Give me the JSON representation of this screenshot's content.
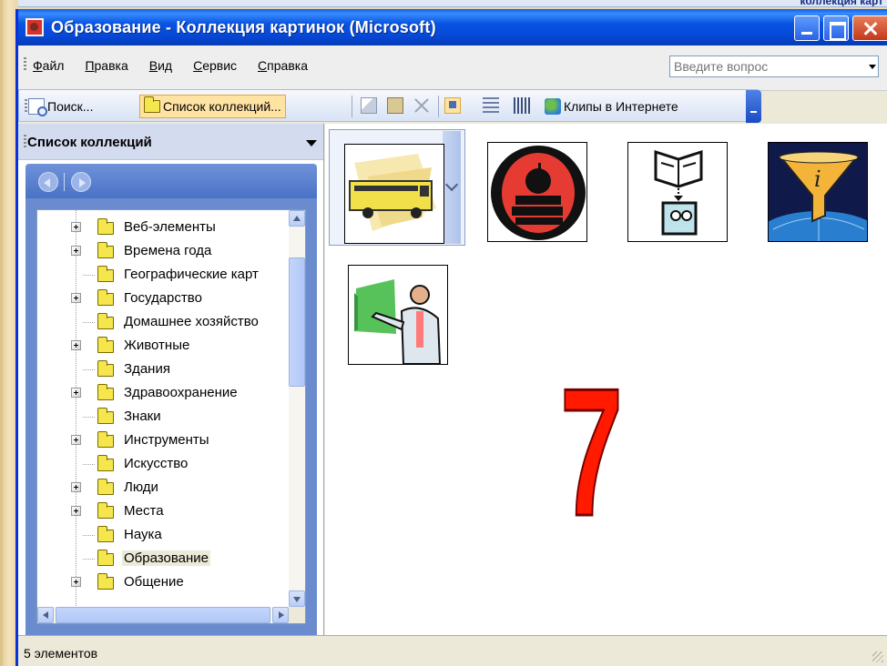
{
  "behind_window": {
    "title_fragment": "коллекция карт"
  },
  "window": {
    "title": "Образование - Коллекция картинок (Microsoft)"
  },
  "menu": {
    "items": [
      "Файл",
      "Правка",
      "Вид",
      "Сервис",
      "Справка"
    ],
    "ask_placeholder": "Введите вопрос"
  },
  "toolbar": {
    "search_label": "Поиск...",
    "collections_label": "Список коллекций...",
    "web_clips_label": "Клипы в Интернете"
  },
  "task_pane": {
    "title": "Список коллекций",
    "tree": [
      {
        "label": "Веб-элементы",
        "expandable": true,
        "selected": false
      },
      {
        "label": "Времена года",
        "expandable": true,
        "selected": false
      },
      {
        "label": "Географические карт",
        "expandable": false,
        "selected": false
      },
      {
        "label": "Государство",
        "expandable": true,
        "selected": false
      },
      {
        "label": "Домашнее хозяйство",
        "expandable": false,
        "selected": false
      },
      {
        "label": "Животные",
        "expandable": true,
        "selected": false
      },
      {
        "label": "Здания",
        "expandable": false,
        "selected": false
      },
      {
        "label": "Здравоохранение",
        "expandable": true,
        "selected": false
      },
      {
        "label": "Знаки",
        "expandable": false,
        "selected": false
      },
      {
        "label": "Инструменты",
        "expandable": true,
        "selected": false
      },
      {
        "label": "Искусство",
        "expandable": false,
        "selected": false
      },
      {
        "label": "Люди",
        "expandable": true,
        "selected": false
      },
      {
        "label": "Места",
        "expandable": true,
        "selected": false
      },
      {
        "label": "Наука",
        "expandable": false,
        "selected": false
      },
      {
        "label": "Образование",
        "expandable": false,
        "selected": true
      },
      {
        "label": "Общение",
        "expandable": true,
        "selected": false
      }
    ]
  },
  "results": {
    "clips": [
      "school-bus-clip",
      "apple-books-clip",
      "book-reader-clip",
      "info-funnel-clip",
      "teacher-chalkboard-clip"
    ],
    "overlay_number": "7"
  },
  "status": {
    "text": "5 элементов"
  },
  "colors": {
    "titlebar": "#0854e3",
    "selection_highlight": "#ffe3a3",
    "overlay_number": "#ff1a00",
    "pane_nav": "#6a8ccf"
  }
}
